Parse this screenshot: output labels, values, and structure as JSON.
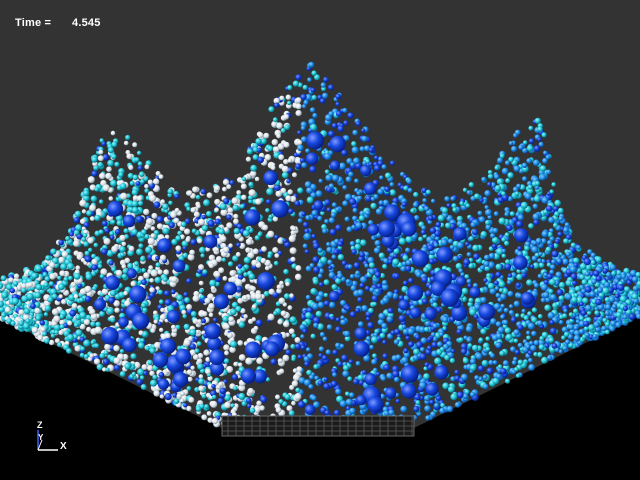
{
  "simulation": {
    "time_label": "Time =",
    "time_value": "4.545"
  },
  "axes": {
    "z": "Z",
    "y": "Y",
    "x": "X"
  },
  "colors": {
    "background": "#333333",
    "floor": "#000000",
    "floor_edge": "#2a2a2a",
    "particle_white": "#e8eef2",
    "particle_cyan": "#22c8d8",
    "particle_light_blue": "#1e8ee8",
    "particle_blue": "#1848e0",
    "particle_dark_blue": "#0a30c8",
    "grate": "#1a1a1a",
    "grate_lines": "#5a5a5a"
  }
}
